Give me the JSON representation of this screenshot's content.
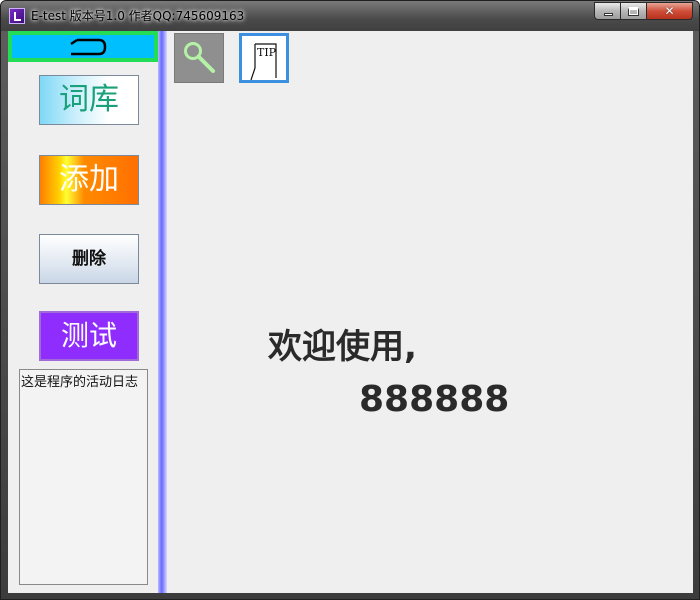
{
  "window": {
    "title": "E-test 版本号1.0  作者QQ:745609163",
    "icon": "app-icon"
  },
  "titlebar_buttons": {
    "minimize_icon": "minimize-icon",
    "maximize_icon": "maximize-icon",
    "close_icon": "close-icon"
  },
  "sidebar": {
    "back_icon": "back-arrow-icon",
    "buttons": {
      "ciku": "词库",
      "tianjia": "添加",
      "shanchu": "删除",
      "ceshi": "测试"
    },
    "log_text": "这是程序的活动日志"
  },
  "toolbar": {
    "search_icon": "search-icon",
    "tip_icon": "tip-icon",
    "tip_label": "TIP"
  },
  "main": {
    "welcome": "欢迎使用,",
    "user": "888888"
  },
  "colors": {
    "back_button_bg": "#00bfff",
    "back_button_border": "#22dd55",
    "test_button_bg": "#8f2dff",
    "divider": "#7a7aff",
    "tip_border": "#3d8fe0"
  }
}
